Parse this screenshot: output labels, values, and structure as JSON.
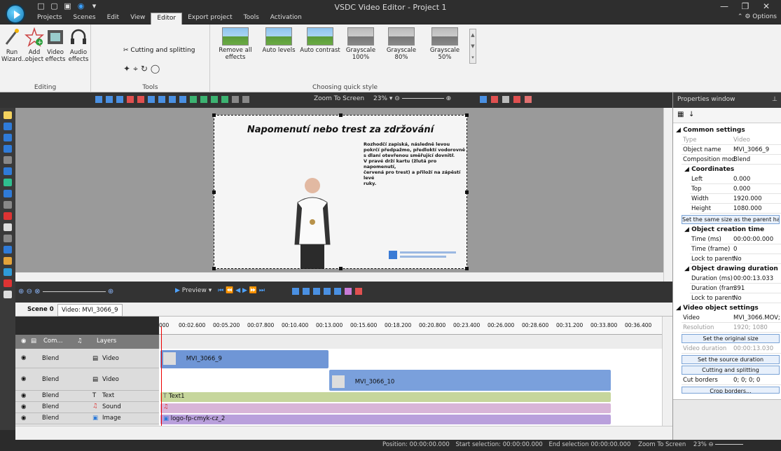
{
  "window": {
    "title": "VSDC Video Editor - Project 1",
    "options_label": "Options"
  },
  "menu": [
    {
      "label": "Projects",
      "active": false
    },
    {
      "label": "Scenes",
      "active": false
    },
    {
      "label": "Edit",
      "active": false
    },
    {
      "label": "View",
      "active": false
    },
    {
      "label": "Editor",
      "active": true
    },
    {
      "label": "Export project",
      "active": false
    },
    {
      "label": "Tools",
      "active": false
    },
    {
      "label": "Activation",
      "active": false
    }
  ],
  "ribbon": {
    "editing": {
      "label": "Editing",
      "run_label": "Run",
      "wizard_label": "Wizard...",
      "add_label": "Add",
      "object_label": "object",
      "video_label": "Video",
      "video_effects_label": "effects",
      "audio_label": "Audio",
      "audio_effects_label": "effects"
    },
    "tools": {
      "label": "Tools",
      "cutting_label": "Cutting and splitting"
    },
    "quick_style": {
      "label": "Choosing quick style",
      "items": [
        {
          "label": "Remove all",
          "label2": "effects"
        },
        {
          "label": "Auto levels",
          "label2": ""
        },
        {
          "label": "Auto contrast",
          "label2": ""
        },
        {
          "label": "Grayscale",
          "label2": "100%"
        },
        {
          "label": "Grayscale 80%",
          "label2": ""
        },
        {
          "label": "Grayscale 50%",
          "label2": ""
        }
      ]
    }
  },
  "preview_toolbar": {
    "zoom_label": "Zoom To Screen",
    "zoom_value": "23%"
  },
  "video_frame": {
    "title": "Napomenutí nebo trest za zdržování",
    "note_lines": [
      "Rozhodčí zapiská, následně levou",
      "pokrčí předpažmo, předloktí vodorovně",
      "s dlaní otevřenou směřující dovnitř.",
      "V pravé drží kartu (žlutá pro napomenutí,",
      "červená pro trest) a přiloží na zápěstí levé",
      "ruky."
    ]
  },
  "timeline": {
    "preview_label": "Preview",
    "tab_scene": "Scene 0",
    "tab_video": "Video: MVI_3066_9",
    "ruler_labels": [
      "000",
      "00:02.600",
      "00:05.200",
      "00:07.800",
      "00:10.400",
      "00:13.000",
      "00:15.600",
      "00:18.200",
      "00:20.800",
      "00:23.400",
      "00:26.000",
      "00:28.600",
      "00:31.200",
      "00:33.800",
      "00:36.400"
    ],
    "header_com": "Com...",
    "header_layers": "Layers",
    "rows": [
      {
        "blend": "Blend",
        "type": "Video",
        "icon": "film-icon"
      },
      {
        "blend": "Blend",
        "type": "Video",
        "icon": "film-icon"
      },
      {
        "blend": "Blend",
        "type": "Text",
        "icon": "text-icon"
      },
      {
        "blend": "Blend",
        "type": "Sound",
        "icon": "music-note-icon"
      },
      {
        "blend": "Blend",
        "type": "Image",
        "icon": "image-icon"
      }
    ],
    "clips": [
      {
        "label": "MVI_3066_9",
        "color": "#6f96d6"
      },
      {
        "label": "MVI_3066_10",
        "color": "#7aa0dc"
      },
      {
        "label": "Text1",
        "color": "#c6d69c"
      },
      {
        "label": "",
        "color": "#d8b5d8"
      },
      {
        "label": "logo-fp-cmyk-cz_2",
        "color": "#b9a0dc"
      }
    ]
  },
  "properties": {
    "title": "Properties window",
    "common_settings": "Common settings",
    "type_key": "Type",
    "type_val": "Video",
    "object_name_key": "Object name",
    "object_name_val": "MVI_3066_9",
    "composition_key": "Composition mod",
    "composition_val": "Blend",
    "coordinates": "Coordinates",
    "left_key": "Left",
    "left_val": "0.000",
    "top_key": "Top",
    "top_val": "0.000",
    "width_key": "Width",
    "width_val": "1920.000",
    "height_key": "Height",
    "height_val": "1080.000",
    "same_size_btn": "Set the same size as the parent has",
    "creation_time": "Object creation time",
    "time_ms_key": "Time (ms)",
    "time_ms_val": "00:00:00.000",
    "time_frame_key": "Time (frame)",
    "time_frame_val": "0",
    "lock_key": "Lock to parent",
    "lock_val": "No",
    "drawing_duration": "Object drawing duration",
    "duration_ms_key": "Duration (ms)",
    "duration_ms_val": "00:00:13.033",
    "duration_frame_key": "Duration (fram",
    "duration_frame_val": "391",
    "lock2_key": "Lock to parent",
    "lock2_val": "No",
    "video_object_settings": "Video object settings",
    "video_key": "Video",
    "video_val": "MVI_3066.MOV;",
    "resolution_key": "Resolution",
    "resolution_val": "1920; 1080",
    "original_size_btn": "Set the original size",
    "video_duration_key": "Video duration",
    "video_duration_val": "00:00:13.030",
    "source_duration_btn": "Set the source duration",
    "cutting_btn": "Cutting and splitting",
    "cut_borders_key": "Cut borders",
    "cut_borders_val": "0; 0; 0; 0",
    "crop_borders_btn": "Crop borders..."
  },
  "status": {
    "position_label": "Position:",
    "position_val": "00:00:00.000",
    "start_label": "Start selection:",
    "start_val": "00:00:00.000",
    "end_label": "End selection",
    "end_val": "00:00:00.000",
    "zoom_label": "Zoom To Screen",
    "zoom_val": "23%"
  }
}
